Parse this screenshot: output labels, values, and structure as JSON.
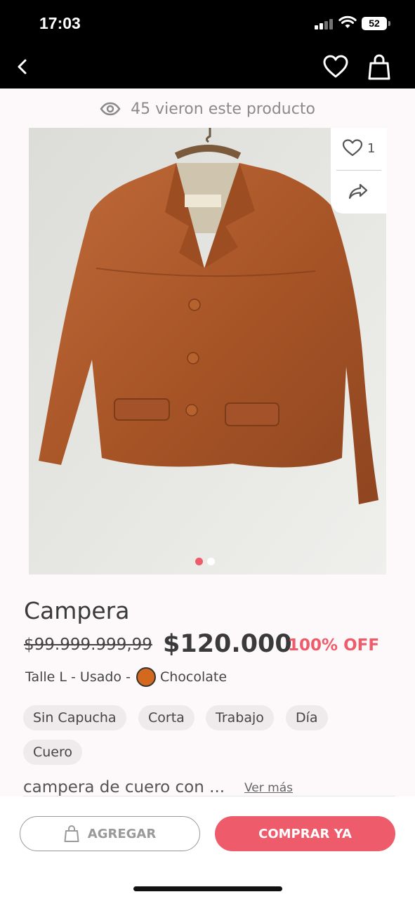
{
  "status_bar": {
    "time": "17:03",
    "battery": "52"
  },
  "nav": {
    "back_icon": "chevron-left-icon",
    "favorite_icon": "heart-icon",
    "cart_icon": "shopping-bag-icon"
  },
  "viewers": {
    "icon": "eye-icon",
    "text": "45 vieron este producto"
  },
  "gallery": {
    "image": "brown leather jacket on hanger",
    "pages": 2,
    "current_page": 1,
    "accent": "#ee5b6a"
  },
  "side_actions": {
    "like_count": "1",
    "share_icon": "share-icon"
  },
  "product": {
    "title": "Campera",
    "old_price": "$99.999.999,99",
    "price": "$120.000",
    "discount": "100% OFF",
    "details_text": "Talle L - Usado -",
    "color_name": "Chocolate",
    "color_hex": "#d2691e",
    "tags": [
      "Sin Capucha",
      "Corta",
      "Trabajo",
      "Día",
      "Cuero"
    ],
    "description": "campera de cuero con ...",
    "see_more": "Ver más"
  },
  "actions": {
    "add_label": "AGREGAR",
    "buy_label": "COMPRAR YA"
  }
}
